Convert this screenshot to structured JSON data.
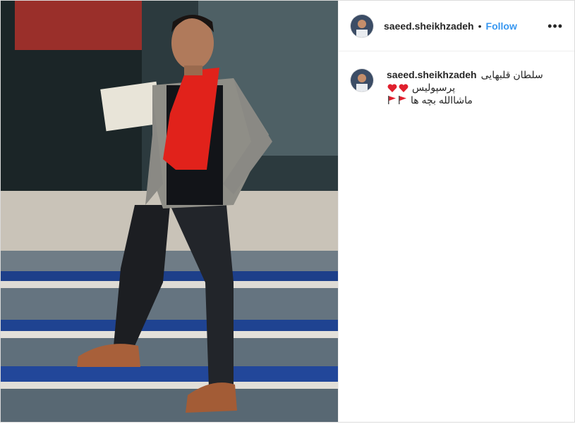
{
  "post": {
    "username": "saeed.sheikhzadeh",
    "follow_label": "Follow",
    "separator": "•",
    "more_label": "•••"
  },
  "caption": {
    "username": "saeed.sheikhzadeh",
    "line1": "سلطان قلبهایی",
    "line2": "پرسپولیس",
    "line3": "ماشاالله بچه ها"
  },
  "icons": {
    "heart": "heart-emoji",
    "flag": "red-flag-emoji"
  },
  "colors": {
    "follow_blue": "#3897f0",
    "text": "#262626",
    "border": "#dbdbdb"
  }
}
